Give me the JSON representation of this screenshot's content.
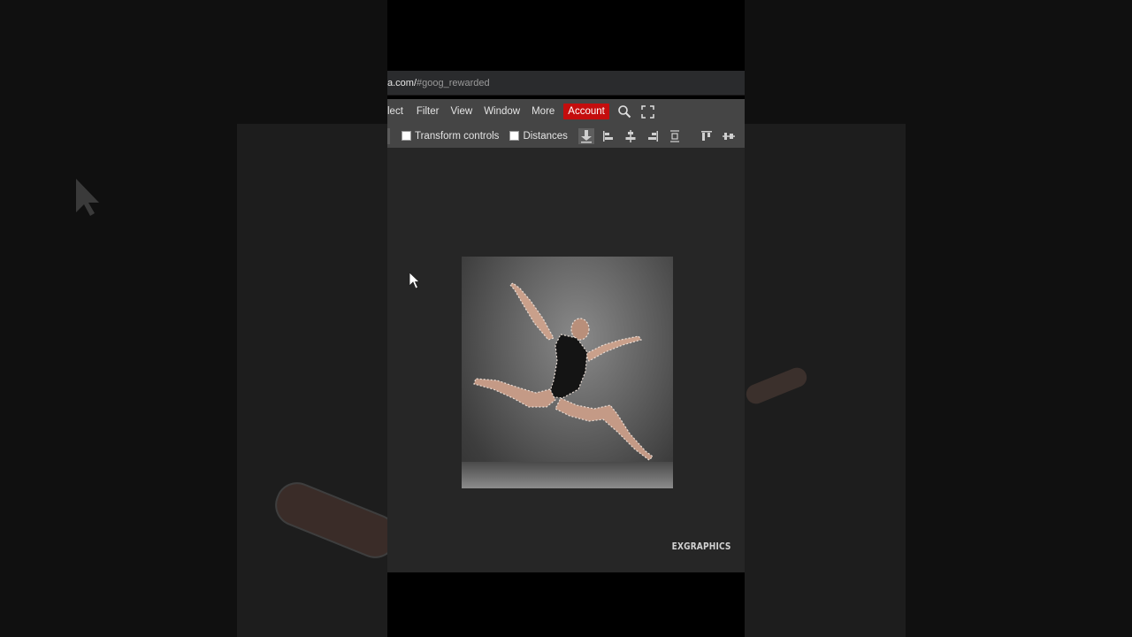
{
  "browser": {
    "url_host": "a.com/",
    "url_hash": "#goog_rewarded"
  },
  "menu": {
    "items": [
      "lect",
      "Filter",
      "View",
      "Window",
      "More"
    ],
    "account_label": "Account",
    "account_color": "#c40d0d",
    "icons": [
      "search-icon",
      "fullscreen-icon"
    ]
  },
  "toolbar": {
    "transform_controls_label": "Transform controls",
    "transform_controls_checked": false,
    "distances_label": "Distances",
    "distances_checked": false,
    "icons": [
      "download-icon",
      "align-left-icon",
      "align-center-icon",
      "align-right-icon",
      "distribute-icon",
      "align-top-icon",
      "align-middle-icon"
    ]
  },
  "canvas": {
    "image_subject": "dancer-leaping-with-selection",
    "watermark": "EXGRAPHICS"
  }
}
